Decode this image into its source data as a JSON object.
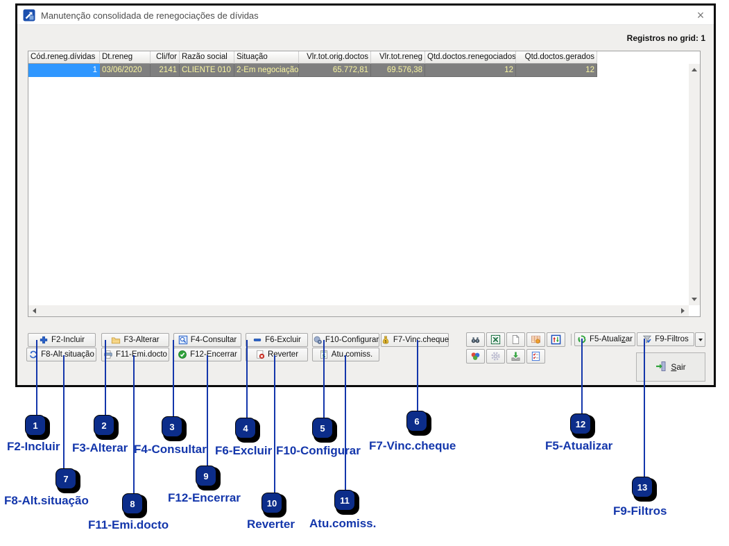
{
  "window": {
    "title": "Manutenção consolidada de renegociações de dívidas",
    "close_glyph": "×",
    "records_info": "Registros no grid: 1"
  },
  "grid": {
    "columns": [
      "Cód.reneg.dívidas",
      "Dt.reneg",
      "Cli/for",
      "Razão social",
      "Situação",
      "Vlr.tot.orig.doctos",
      "Vlr.tot.reneg",
      "Qtd.doctos.renegociados",
      "Qtd.doctos.gerados"
    ],
    "row": [
      "1",
      "03/06/2020",
      "2141",
      "CLIENTE 010",
      "2-Em negociação",
      "65.772,81",
      "69.576,38",
      "12",
      "12"
    ]
  },
  "toolbar": {
    "row1": [
      "F2-Incluir",
      "F3-Alterar",
      "F4-Consultar",
      "F6-Excluir",
      "F10-Configurar",
      "F7-Vinc.cheque"
    ],
    "row2": [
      "F8-Alt.situação",
      "F11-Emi.docto",
      "F12-Encerrar",
      "Reverter",
      "Atu.comiss."
    ],
    "icon_buttons_row1": [
      "binoculars-icon",
      "excel-export-icon",
      "new-document-icon",
      "table-edit-icon",
      "column-order-icon"
    ],
    "icon_buttons_row2": [
      "color-balls-icon",
      "gear-icon",
      "import-icon",
      "checklist-icon"
    ],
    "f5": {
      "pre": "F5-Atuali",
      "accesskey": "z",
      "post": "ar"
    },
    "f9": {
      "label": "F9-Filtros"
    },
    "sair": {
      "accesskey": "S",
      "post": "air"
    }
  },
  "callouts": [
    {
      "n": "1",
      "label": "F2-Incluir"
    },
    {
      "n": "2",
      "label": "F3-Alterar"
    },
    {
      "n": "3",
      "label": "F4-Consultar"
    },
    {
      "n": "4",
      "label": "F6-Excluir"
    },
    {
      "n": "5",
      "label": "F10-Configurar"
    },
    {
      "n": "6",
      "label": "F7-Vinc.cheque"
    },
    {
      "n": "7",
      "label": "F8-Alt.situação"
    },
    {
      "n": "8",
      "label": "F11-Emi.docto"
    },
    {
      "n": "9",
      "label": "F12-Encerrar"
    },
    {
      "n": "10",
      "label": "Reverter"
    },
    {
      "n": "11",
      "label": "Atu.comiss."
    },
    {
      "n": "12",
      "label": "F5-Atualizar"
    },
    {
      "n": "13",
      "label": "F9-Filtros"
    }
  ],
  "colors": {
    "selection_blue": "#2f97ff",
    "row_gray": "#7f7f7f",
    "row_text_yellow": "#faf6a0",
    "callout_blue": "#0c2d8a",
    "annotation_text_blue": "#1336ab"
  }
}
